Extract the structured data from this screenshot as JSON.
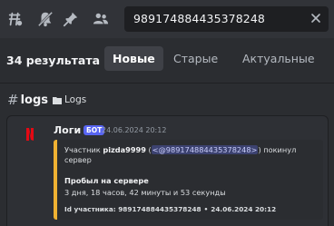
{
  "toolbar": {
    "icons": [
      "threads-icon",
      "mute-bell-icon",
      "pin-icon",
      "members-icon"
    ],
    "search_value": "989174884435378248"
  },
  "results": {
    "count": "34 результата",
    "tabs": [
      {
        "label": "Новые",
        "active": true
      },
      {
        "label": "Старые",
        "active": false
      },
      {
        "label": "Актуальные",
        "active": false
      }
    ]
  },
  "channel": {
    "hash": "#",
    "name": "logs",
    "category": "Logs"
  },
  "message": {
    "author": "Логи",
    "badge": "БОТ",
    "timestamp": "24.06.2024 20:12",
    "embed": {
      "line_prefix": "Участник ",
      "username": "pizda9999",
      "mention": "<@989174884435378248>",
      "line_suffix": " покинул сервер",
      "field_name": "Пробыл на сервере",
      "field_value": "3 дня, 18 часов, 42 минуты и 53 секунды",
      "footer_id": "Id участника: 989174884435378248",
      "footer_sep": "•",
      "footer_time": "24.06.2024 20:12",
      "accent_color": "#f0b232"
    }
  },
  "colors": {
    "bot_badge": "#5865f2",
    "avatar_logo": "#e50914"
  }
}
